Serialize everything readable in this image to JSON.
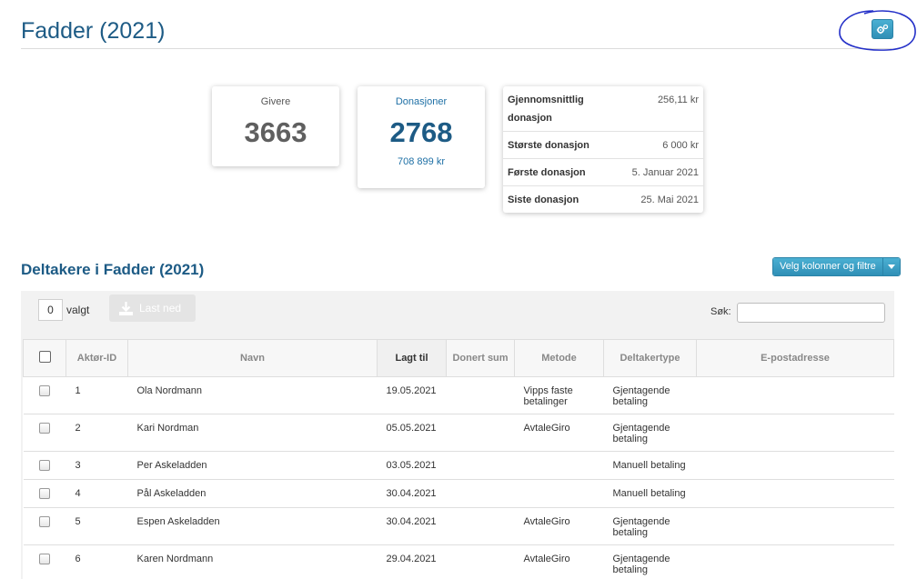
{
  "page": {
    "title": "Fadder (2021)"
  },
  "settings_button": {
    "icon": "gears-icon",
    "color": "#3aa0c8"
  },
  "stats": {
    "givere": {
      "label": "Givere",
      "value": "3663"
    },
    "donasjoner": {
      "label": "Donasjoner",
      "value": "2768",
      "sum": "708 899 kr"
    }
  },
  "info": [
    {
      "key": "Gjennomsnittlig donasjon",
      "value": "256,11 kr"
    },
    {
      "key": "Største donasjon",
      "value": "6 000 kr"
    },
    {
      "key": "Første donasjon",
      "value": "5. Januar 2021"
    },
    {
      "key": "Siste donasjon",
      "value": "25. Mai 2021"
    }
  ],
  "section": {
    "title": "Deltakere i Fadder (2021)"
  },
  "columns_button": {
    "label": "Velg kolonner og filtre"
  },
  "toolbar": {
    "selected_count": "0",
    "selected_label": "valgt",
    "download_label": "Last ned",
    "search_label": "Søk:",
    "search_value": ""
  },
  "table": {
    "headers": [
      "Aktør-ID",
      "Navn",
      "Lagt til",
      "Donert sum",
      "Metode",
      "Deltakertype",
      "E-postadresse"
    ],
    "rows": [
      {
        "id": "1",
        "name": "Ola Nordmann",
        "added": "19.05.2021",
        "sum": "",
        "method": "Vipps faste betalinger",
        "type": "Gjentagende betaling",
        "email": ""
      },
      {
        "id": "2",
        "name": "Kari Nordman",
        "added": "05.05.2021",
        "sum": "",
        "method": "AvtaleGiro",
        "type": "Gjentagende betaling",
        "email": ""
      },
      {
        "id": "3",
        "name": "Per Askeladden",
        "added": "03.05.2021",
        "sum": "",
        "method": "",
        "type": "Manuell betaling",
        "email": ""
      },
      {
        "id": "4",
        "name": "Pål Askeladden",
        "added": "30.04.2021",
        "sum": "",
        "method": "",
        "type": "Manuell betaling",
        "email": ""
      },
      {
        "id": "5",
        "name": "Espen Askeladden",
        "added": "30.04.2021",
        "sum": "",
        "method": "AvtaleGiro",
        "type": "Gjentagende betaling",
        "email": ""
      },
      {
        "id": "6",
        "name": "Karen Nordmann",
        "added": "29.04.2021",
        "sum": "",
        "method": "AvtaleGiro",
        "type": "Gjentagende betaling",
        "email": ""
      }
    ]
  }
}
